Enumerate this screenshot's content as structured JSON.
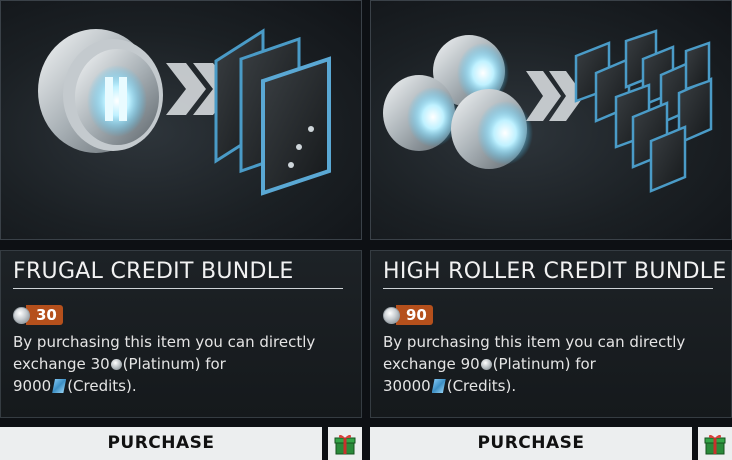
{
  "bundles": [
    {
      "title": "FRUGAL CREDIT BUNDLE",
      "price": "30",
      "desc_prefix": "By purchasing this item you can directly exchange ",
      "plat_amount": "30",
      "plat_label": "(Platinum) for",
      "credit_amount": "9000",
      "credit_label": "(Credits).",
      "purchase_label": "PURCHASE",
      "gift_icon": "gift-icon"
    },
    {
      "title": "HIGH ROLLER CREDIT BUNDLE",
      "price": "90",
      "desc_prefix": "By purchasing this item you can directly exchange ",
      "plat_amount": "90",
      "plat_label": "(Platinum) for",
      "credit_amount": "30000",
      "credit_label": "(Credits).",
      "purchase_label": "PURCHASE",
      "gift_icon": "gift-icon"
    }
  ],
  "colors": {
    "price_badge": "#b5501c",
    "purchase_bg": "#eceeef",
    "card_bg": "#1d2226"
  }
}
